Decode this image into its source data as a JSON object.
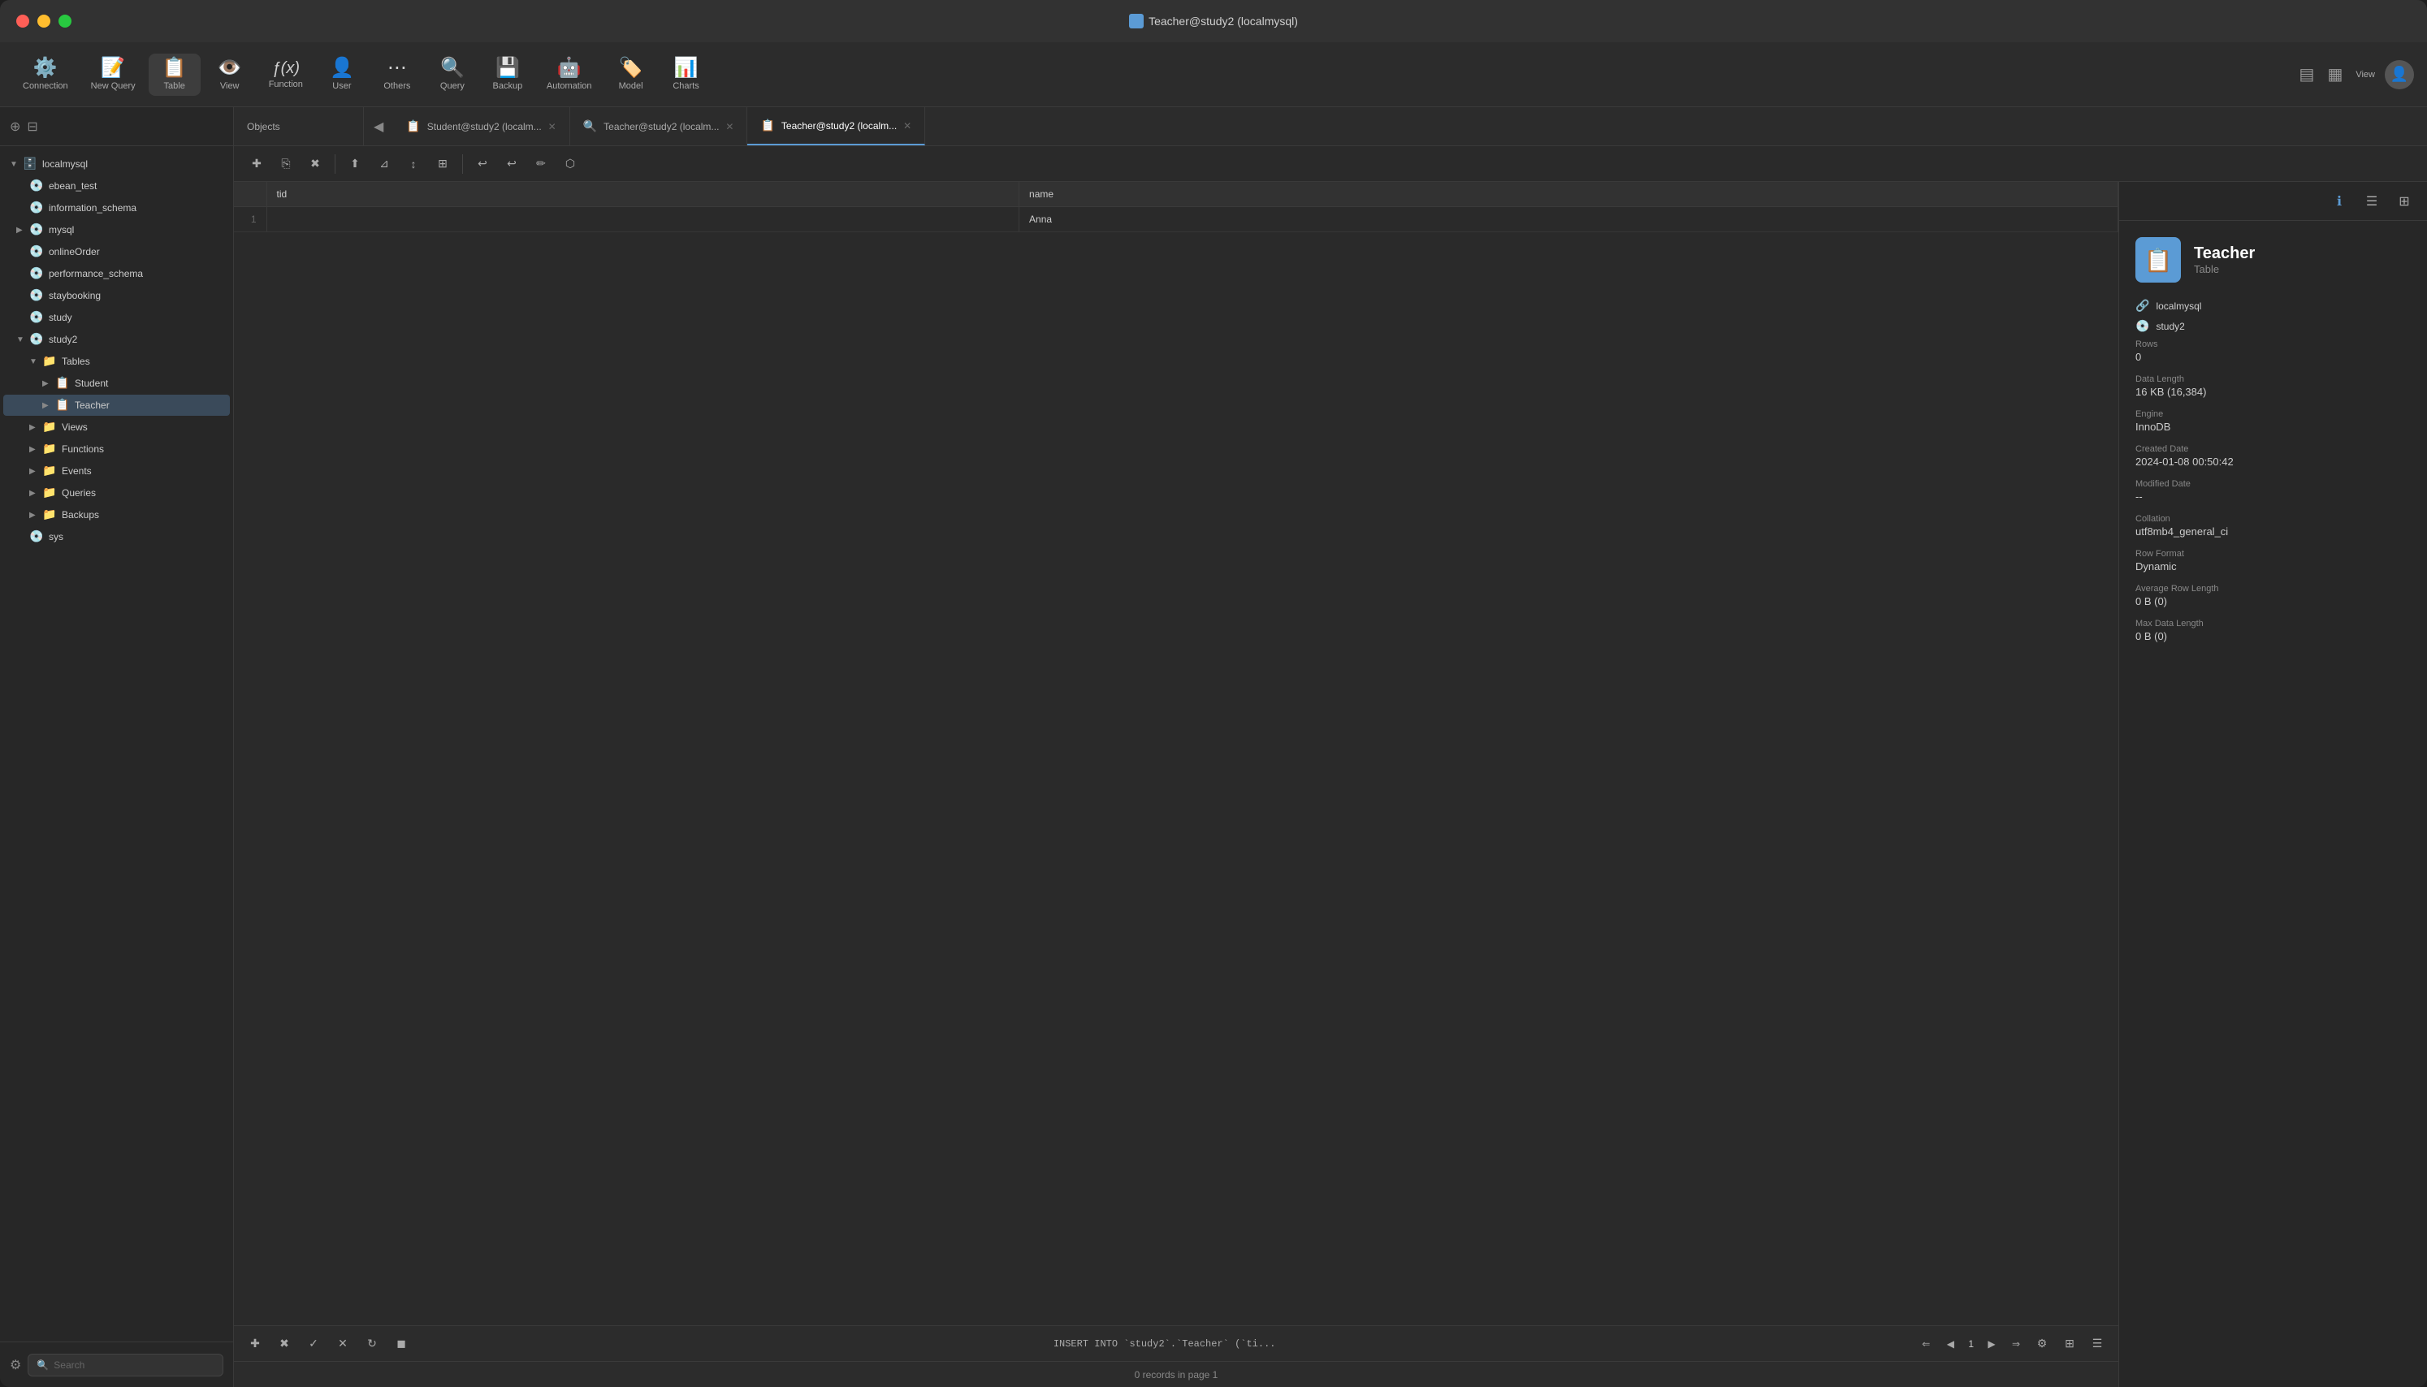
{
  "window": {
    "title": "Teacher@study2 (localmysql)",
    "titlebar_icon": "🖥️"
  },
  "toolbar": {
    "items": [
      {
        "id": "connection",
        "icon": "⚙️",
        "label": "Connection"
      },
      {
        "id": "new-query",
        "icon": "📝",
        "label": "New Query"
      },
      {
        "id": "table",
        "icon": "📋",
        "label": "Table"
      },
      {
        "id": "view",
        "icon": "👁️",
        "label": "View"
      },
      {
        "id": "function",
        "icon": "ƒ",
        "label": "Function"
      },
      {
        "id": "user",
        "icon": "👤",
        "label": "User"
      },
      {
        "id": "others",
        "icon": "⋯",
        "label": "Others"
      },
      {
        "id": "query",
        "icon": "🔍",
        "label": "Query"
      },
      {
        "id": "backup",
        "icon": "💾",
        "label": "Backup"
      },
      {
        "id": "automation",
        "icon": "🤖",
        "label": "Automation"
      },
      {
        "id": "model",
        "icon": "🏷️",
        "label": "Model"
      },
      {
        "id": "charts",
        "icon": "📊",
        "label": "Charts"
      }
    ],
    "view_label": "View"
  },
  "sidebar": {
    "root_label": "localmysql",
    "tree_items": [
      {
        "id": "localmysql",
        "label": "localmysql",
        "indent": 0,
        "type": "root",
        "chevron": "▼",
        "icon": "🗄️"
      },
      {
        "id": "ebean_test",
        "label": "ebean_test",
        "indent": 1,
        "type": "db",
        "chevron": "",
        "icon": "💿"
      },
      {
        "id": "information_schema",
        "label": "information_schema",
        "indent": 1,
        "type": "db",
        "chevron": "",
        "icon": "💿"
      },
      {
        "id": "mysql",
        "label": "mysql",
        "indent": 1,
        "type": "db",
        "chevron": "▶",
        "icon": "💿"
      },
      {
        "id": "onlineOrder",
        "label": "onlineOrder",
        "indent": 1,
        "type": "db",
        "chevron": "",
        "icon": "💿"
      },
      {
        "id": "performance_schema",
        "label": "performance_schema",
        "indent": 1,
        "type": "db",
        "chevron": "",
        "icon": "💿"
      },
      {
        "id": "staybooking",
        "label": "staybooking",
        "indent": 1,
        "type": "db",
        "chevron": "",
        "icon": "💿"
      },
      {
        "id": "study",
        "label": "study",
        "indent": 1,
        "type": "db",
        "chevron": "",
        "icon": "💿"
      },
      {
        "id": "study2",
        "label": "study2",
        "indent": 1,
        "type": "db-open",
        "chevron": "▼",
        "icon": "💿"
      },
      {
        "id": "tables",
        "label": "Tables",
        "indent": 2,
        "type": "folder",
        "chevron": "▼",
        "icon": "📁"
      },
      {
        "id": "student",
        "label": "Student",
        "indent": 3,
        "type": "table",
        "chevron": "▶",
        "icon": "📋"
      },
      {
        "id": "teacher",
        "label": "Teacher",
        "indent": 3,
        "type": "table-selected",
        "chevron": "▶",
        "icon": "📋"
      },
      {
        "id": "views",
        "label": "Views",
        "indent": 2,
        "type": "folder",
        "chevron": "▶",
        "icon": "📁"
      },
      {
        "id": "functions",
        "label": "Functions",
        "indent": 2,
        "type": "folder",
        "chevron": "▶",
        "icon": "📁"
      },
      {
        "id": "events",
        "label": "Events",
        "indent": 2,
        "type": "folder",
        "chevron": "▶",
        "icon": "📁"
      },
      {
        "id": "queries",
        "label": "Queries",
        "indent": 2,
        "type": "folder",
        "chevron": "▶",
        "icon": "📁"
      },
      {
        "id": "backups",
        "label": "Backups",
        "indent": 2,
        "type": "folder",
        "chevron": "▶",
        "icon": "📁"
      },
      {
        "id": "sys",
        "label": "sys",
        "indent": 1,
        "type": "db",
        "chevron": "",
        "icon": "💿"
      }
    ],
    "search_placeholder": "Search"
  },
  "tabs": {
    "items": [
      {
        "id": "objects",
        "label": "Objects",
        "icon": "",
        "active": false,
        "closable": false
      },
      {
        "id": "student",
        "label": "Student@study2 (localm...",
        "icon": "📋",
        "active": false,
        "closable": true
      },
      {
        "id": "teacher-query",
        "label": "Teacher@study2 (localm...",
        "icon": "🔍",
        "active": false,
        "closable": true
      },
      {
        "id": "teacher-table",
        "label": "Teacher@study2 (localm...",
        "icon": "📋",
        "active": true,
        "closable": true
      }
    ]
  },
  "table_data": {
    "columns": [
      {
        "id": "tid",
        "label": "tid"
      },
      {
        "id": "name",
        "label": "name"
      }
    ],
    "rows": [
      {
        "row_num": "1",
        "tid": "",
        "name": "Anna"
      }
    ],
    "records_info": "0 records in page 1"
  },
  "action_toolbar": {
    "buttons": [
      {
        "id": "add-row",
        "icon": "✚",
        "tooltip": "Add Row"
      },
      {
        "id": "copy-row",
        "icon": "⎘",
        "tooltip": "Copy Row"
      },
      {
        "id": "delete-row",
        "icon": "✖",
        "tooltip": "Delete Row"
      },
      {
        "id": "sep1",
        "type": "separator"
      },
      {
        "id": "export",
        "icon": "⬆",
        "tooltip": "Export"
      },
      {
        "id": "filter",
        "icon": "⊿",
        "tooltip": "Filter"
      },
      {
        "id": "sort",
        "icon": "↕",
        "tooltip": "Sort"
      },
      {
        "id": "grid",
        "icon": "⊞",
        "tooltip": "Grid View"
      },
      {
        "id": "sep2",
        "type": "separator"
      },
      {
        "id": "refresh",
        "icon": "↻",
        "tooltip": "Refresh"
      },
      {
        "id": "back",
        "icon": "↩",
        "tooltip": "Back"
      },
      {
        "id": "field-edit",
        "icon": "✏",
        "tooltip": "Field Edit"
      },
      {
        "id": "chart",
        "icon": "⬡",
        "tooltip": "Chart"
      }
    ]
  },
  "status_bar": {
    "sql_text": "INSERT INTO `study2`.`Teacher` (`ti...",
    "page_num": "1",
    "pagination_btns": [
      "⇐",
      "◀",
      "▶",
      "⇒"
    ],
    "records_text": "0 records in page 1"
  },
  "info_panel": {
    "table_name": "Teacher",
    "table_type": "Table",
    "connection": "localmysql",
    "database": "study2",
    "rows_label": "Rows",
    "rows_value": "0",
    "data_length_label": "Data Length",
    "data_length_value": "16 KB (16,384)",
    "engine_label": "Engine",
    "engine_value": "InnoDB",
    "created_date_label": "Created Date",
    "created_date_value": "2024-01-08 00:50:42",
    "modified_date_label": "Modified Date",
    "modified_date_value": "--",
    "collation_label": "Collation",
    "collation_value": "utf8mb4_general_ci",
    "row_format_label": "Row Format",
    "row_format_value": "Dynamic",
    "avg_row_length_label": "Average Row Length",
    "avg_row_length_value": "0 B (0)",
    "max_data_length_label": "Max Data Length",
    "max_data_length_value": "0 B (0)"
  }
}
